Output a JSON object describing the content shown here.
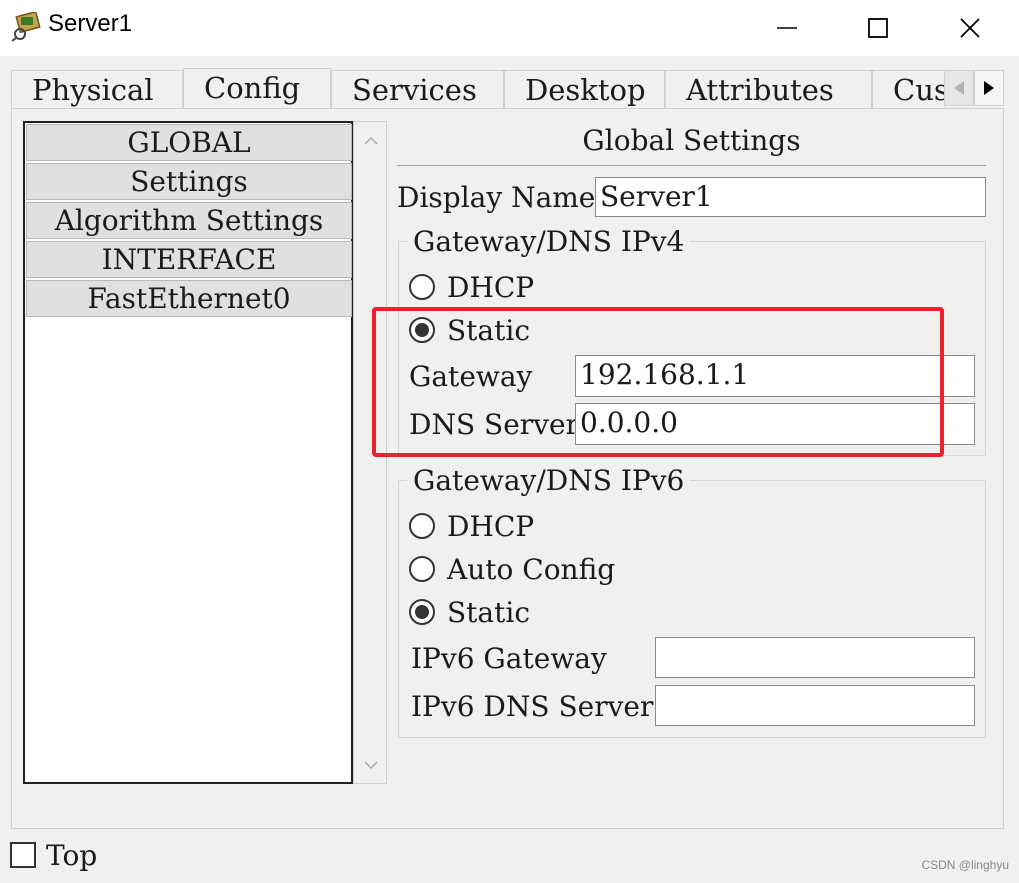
{
  "window": {
    "title": "Server1",
    "icons": [
      "app-icon",
      "minimize-icon",
      "maximize-icon",
      "close-icon"
    ]
  },
  "tabs": [
    {
      "label": "Physical"
    },
    {
      "label": "Config",
      "active": true
    },
    {
      "label": "Services"
    },
    {
      "label": "Desktop"
    },
    {
      "label": "Attributes"
    },
    {
      "label": "Cus"
    }
  ],
  "sidebar": {
    "items": [
      "GLOBAL",
      "Settings",
      "Algorithm Settings",
      "INTERFACE",
      "FastEthernet0"
    ]
  },
  "main": {
    "heading": "Global Settings",
    "display_name_label": "Display Name",
    "display_name_value": "Server1",
    "ipv4": {
      "group_title": "Gateway/DNS IPv4",
      "dhcp_label": "DHCP",
      "static_label": "Static",
      "selected": "Static",
      "gateway_label": "Gateway",
      "gateway_value": "192.168.1.1",
      "dns_label": "DNS Server",
      "dns_value": "0.0.0.0"
    },
    "ipv6": {
      "group_title": "Gateway/DNS IPv6",
      "dhcp_label": "DHCP",
      "auto_label": "Auto Config",
      "static_label": "Static",
      "selected": "Static",
      "gateway_label": "IPv6 Gateway",
      "gateway_value": "",
      "dns_label": "IPv6 DNS Server",
      "dns_value": ""
    }
  },
  "footer": {
    "top_label": "Top",
    "watermark": "CSDN @linghyu"
  },
  "colors": {
    "highlight": "#e8232a",
    "background": "#f0f0f0"
  }
}
